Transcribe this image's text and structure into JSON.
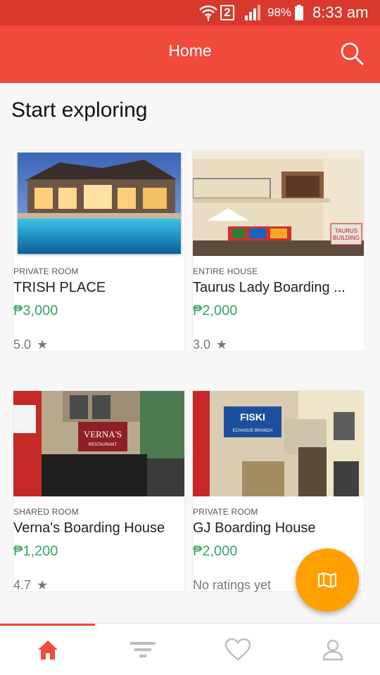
{
  "status_bar": {
    "sim_slot": "2",
    "battery": "98%",
    "time": "8:33 am"
  },
  "app_bar": {
    "title": "Home"
  },
  "main": {
    "heading": "Start exploring",
    "listings": [
      {
        "type": "PRIVATE ROOM",
        "name": "TRISH PLACE",
        "price": "₱3,000",
        "rating": "5.0"
      },
      {
        "type": "ENTIRE HOUSE",
        "name": "Taurus Lady Boarding ...",
        "price": "₱2,000",
        "rating": "3.0"
      },
      {
        "type": "SHARED ROOM",
        "name": "Verna's Boarding House",
        "price": "₱1,200",
        "rating": "4.7"
      },
      {
        "type": "PRIVATE ROOM",
        "name": "GJ Boarding House",
        "price": "₱2,000",
        "rating": "No ratings yet"
      }
    ],
    "star_glyph": "★",
    "photo_signs": [
      "VERNA'S",
      "RESTAURANT",
      "FISKI",
      "ECHAGUE BRANCH",
      "TAURUS",
      "BUILDING"
    ]
  },
  "fab": {
    "icon": "map-icon"
  },
  "bottom_nav": {
    "tabs": [
      {
        "icon": "home-icon",
        "active": true
      },
      {
        "icon": "filter-icon",
        "active": false
      },
      {
        "icon": "heart-icon",
        "active": false
      },
      {
        "icon": "profile-icon",
        "active": false
      }
    ]
  },
  "colors": {
    "status_bar": "#d8392c",
    "app_bar": "#ef4a3c",
    "price": "#3ba35f",
    "fab": "#ffa000",
    "active_tab": "#ef4a3c",
    "inactive_tab": "#bdbdbd"
  }
}
